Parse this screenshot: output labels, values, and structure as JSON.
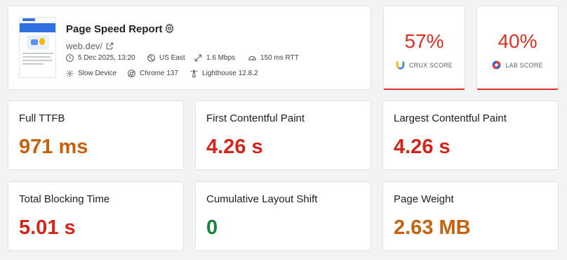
{
  "report": {
    "title": "Page Speed Report",
    "url": "web.dev/",
    "meta": {
      "date": "5 Dec 2025, 13:20",
      "location": "US East",
      "bandwidth": "1.6 Mbps",
      "latency": "150 ms RTT",
      "device": "Slow Device",
      "browser": "Chrome 137",
      "lighthouse": "Lighthouse 12.8.2"
    }
  },
  "scores": {
    "crux": {
      "value": "57%",
      "label": "CRUX SCORE"
    },
    "lab": {
      "value": "40%",
      "label": "LAB SCORE"
    }
  },
  "metrics": [
    {
      "label": "Full TTFB",
      "value": "971 ms",
      "color": "#c5620b"
    },
    {
      "label": "First Contentful Paint",
      "value": "4.26 s",
      "color": "#d2251c"
    },
    {
      "label": "Largest Contentful Paint",
      "value": "4.26 s",
      "color": "#d2251c"
    },
    {
      "label": "Total Blocking Time",
      "value": "5.01 s",
      "color": "#d2251c"
    },
    {
      "label": "Cumulative Layout Shift",
      "value": "0",
      "color": "#168240"
    },
    {
      "label": "Page Weight",
      "value": "2.63 MB",
      "color": "#c5620b"
    }
  ],
  "colors": {
    "poor": "#d2251c",
    "needs_improvement": "#c5620b",
    "good": "#168240",
    "score_accent": "#d93025"
  },
  "icons": {
    "settings": "gear-icon",
    "external": "external-link-icon",
    "date": "clock-icon",
    "location": "globe-icon",
    "bandwidth": "bandwidth-icon",
    "latency": "gauge-icon",
    "device": "cpu-gear-icon",
    "browser": "chrome-icon",
    "lighthouse": "lighthouse-icon",
    "crux": "crux-logo-icon",
    "lab": "lab-logo-icon"
  }
}
